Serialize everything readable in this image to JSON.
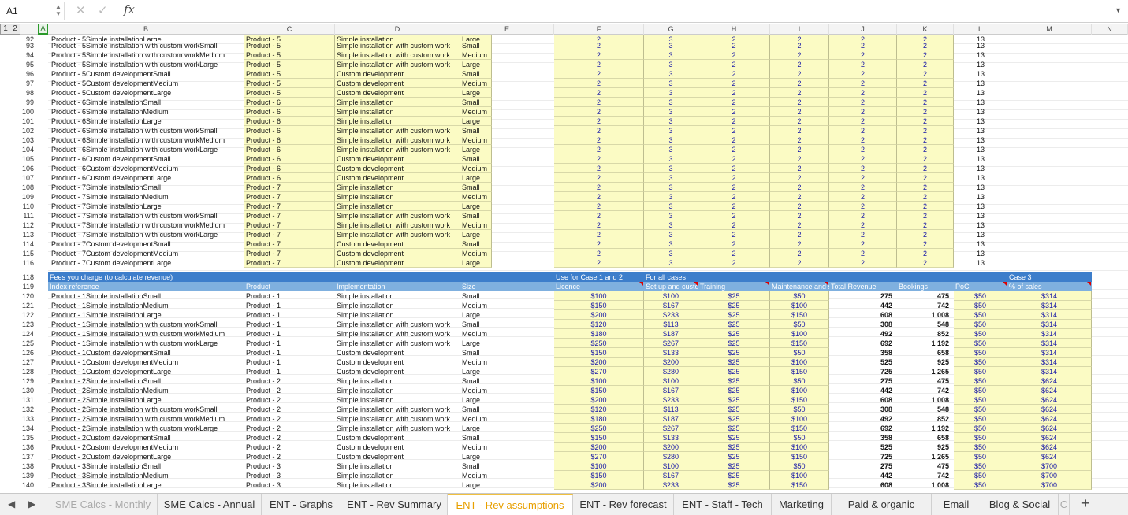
{
  "formula_bar": {
    "cell_ref": "A1",
    "fx": "fx",
    "value": "",
    "cancel_glyph": "✕",
    "confirm_glyph": "✓"
  },
  "outline_levels": [
    "1",
    "2"
  ],
  "columns": [
    "A",
    "B",
    "C",
    "D",
    "E",
    "F",
    "G",
    "H",
    "I",
    "J",
    "K",
    "L",
    "M",
    "N"
  ],
  "top_rows": {
    "numbers": [
      "92",
      "93",
      "94",
      "95",
      "96",
      "97",
      "98",
      "99",
      "100",
      "101",
      "102",
      "103",
      "104",
      "105",
      "106",
      "107",
      "108",
      "109",
      "110",
      "111",
      "112",
      "113",
      "114",
      "115",
      "116"
    ],
    "B": [
      "Product - 5Simple installationLarge",
      "Product - 5Simple installation with custom workSmall",
      "Product - 5Simple installation with custom workMedium",
      "Product - 5Simple installation with custom workLarge",
      "Product - 5Custom developmentSmall",
      "Product - 5Custom developmentMedium",
      "Product - 5Custom developmentLarge",
      "Product - 6Simple installationSmall",
      "Product - 6Simple installationMedium",
      "Product - 6Simple installationLarge",
      "Product - 6Simple installation with custom workSmall",
      "Product - 6Simple installation with custom workMedium",
      "Product - 6Simple installation with custom workLarge",
      "Product - 6Custom developmentSmall",
      "Product - 6Custom developmentMedium",
      "Product - 6Custom developmentLarge",
      "Product - 7Simple installationSmall",
      "Product - 7Simple installationMedium",
      "Product - 7Simple installationLarge",
      "Product - 7Simple installation with custom workSmall",
      "Product - 7Simple installation with custom workMedium",
      "Product - 7Simple installation with custom workLarge",
      "Product - 7Custom developmentSmall",
      "Product - 7Custom developmentMedium",
      "Product - 7Custom developmentLarge"
    ],
    "C": [
      "Product - 5",
      "Product - 5",
      "Product - 5",
      "Product - 5",
      "Product - 5",
      "Product - 5",
      "Product - 5",
      "Product - 6",
      "Product - 6",
      "Product - 6",
      "Product - 6",
      "Product - 6",
      "Product - 6",
      "Product - 6",
      "Product - 6",
      "Product - 6",
      "Product - 7",
      "Product - 7",
      "Product - 7",
      "Product - 7",
      "Product - 7",
      "Product - 7",
      "Product - 7",
      "Product - 7",
      "Product - 7"
    ],
    "D": [
      "Simple installation",
      "Simple installation with custom work",
      "Simple installation with custom work",
      "Simple installation with custom work",
      "Custom development",
      "Custom development",
      "Custom development",
      "Simple installation",
      "Simple installation",
      "Simple installation",
      "Simple installation with custom work",
      "Simple installation with custom work",
      "Simple installation with custom work",
      "Custom development",
      "Custom development",
      "Custom development",
      "Simple installation",
      "Simple installation",
      "Simple installation",
      "Simple installation with custom work",
      "Simple installation with custom work",
      "Simple installation with custom work",
      "Custom development",
      "Custom development",
      "Custom development"
    ],
    "E": [
      "Large",
      "Small",
      "Medium",
      "Large",
      "Small",
      "Medium",
      "Large",
      "Small",
      "Medium",
      "Large",
      "Small",
      "Medium",
      "Large",
      "Small",
      "Medium",
      "Large",
      "Small",
      "Medium",
      "Large",
      "Small",
      "Medium",
      "Large",
      "Small",
      "Medium",
      "Large"
    ],
    "F": "2",
    "G": "3",
    "H": "2",
    "I": "2",
    "J": "2",
    "K": "2",
    "L": "13"
  },
  "section2": {
    "header_row_number": "118",
    "header_title": "Fees you charge (to calculate revenue)",
    "header_use_case": "Use for Case 1 and 2",
    "header_all_cases": "For all cases",
    "header_case3": "Case 3",
    "subheader_row_number": "119",
    "subheaders": {
      "B": "Index reference",
      "C": "Product",
      "D": "Implementation",
      "E": "Size",
      "F": "Licence",
      "G": "Set up and customisation",
      "H": "Training",
      "I": "Maintenance and support",
      "J": "Total Revenue",
      "K": "Bookings",
      "L": "PoC",
      "M": "% of sales"
    },
    "numbers": [
      "120",
      "121",
      "122",
      "123",
      "124",
      "125",
      "126",
      "127",
      "128",
      "129",
      "130",
      "131",
      "132",
      "133",
      "134",
      "135",
      "136",
      "137",
      "138",
      "139",
      "140"
    ],
    "B": [
      "Product - 1Simple installationSmall",
      "Product - 1Simple installationMedium",
      "Product - 1Simple installationLarge",
      "Product - 1Simple installation with custom workSmall",
      "Product - 1Simple installation with custom workMedium",
      "Product - 1Simple installation with custom workLarge",
      "Product - 1Custom developmentSmall",
      "Product - 1Custom developmentMedium",
      "Product - 1Custom developmentLarge",
      "Product - 2Simple installationSmall",
      "Product - 2Simple installationMedium",
      "Product - 2Simple installationLarge",
      "Product - 2Simple installation with custom workSmall",
      "Product - 2Simple installation with custom workMedium",
      "Product - 2Simple installation with custom workLarge",
      "Product - 2Custom developmentSmall",
      "Product - 2Custom developmentMedium",
      "Product - 2Custom developmentLarge",
      "Product - 3Simple installationSmall",
      "Product - 3Simple installationMedium",
      "Product - 3Simple installationLarge"
    ],
    "C": [
      "Product - 1",
      "Product - 1",
      "Product - 1",
      "Product - 1",
      "Product - 1",
      "Product - 1",
      "Product - 1",
      "Product - 1",
      "Product - 1",
      "Product - 2",
      "Product - 2",
      "Product - 2",
      "Product - 2",
      "Product - 2",
      "Product - 2",
      "Product - 2",
      "Product - 2",
      "Product - 2",
      "Product - 3",
      "Product - 3",
      "Product - 3"
    ],
    "D": [
      "Simple installation",
      "Simple installation",
      "Simple installation",
      "Simple installation with custom work",
      "Simple installation with custom work",
      "Simple installation with custom work",
      "Custom development",
      "Custom development",
      "Custom development",
      "Simple installation",
      "Simple installation",
      "Simple installation",
      "Simple installation with custom work",
      "Simple installation with custom work",
      "Simple installation with custom work",
      "Custom development",
      "Custom development",
      "Custom development",
      "Simple installation",
      "Simple installation",
      "Simple installation"
    ],
    "E": [
      "Small",
      "Medium",
      "Large",
      "Small",
      "Medium",
      "Large",
      "Small",
      "Medium",
      "Large",
      "Small",
      "Medium",
      "Large",
      "Small",
      "Medium",
      "Large",
      "Small",
      "Medium",
      "Large",
      "Small",
      "Medium",
      "Large"
    ],
    "F": [
      "$100",
      "$150",
      "$200",
      "$120",
      "$180",
      "$250",
      "$150",
      "$200",
      "$270",
      "$100",
      "$150",
      "$200",
      "$120",
      "$180",
      "$250",
      "$150",
      "$200",
      "$270",
      "$100",
      "$150",
      "$200"
    ],
    "G": [
      "$100",
      "$167",
      "$233",
      "$113",
      "$187",
      "$267",
      "$133",
      "$200",
      "$280",
      "$100",
      "$167",
      "$233",
      "$113",
      "$187",
      "$267",
      "$133",
      "$200",
      "$280",
      "$100",
      "$167",
      "$233"
    ],
    "H": [
      "$25",
      "$25",
      "$25",
      "$25",
      "$25",
      "$25",
      "$25",
      "$25",
      "$25",
      "$25",
      "$25",
      "$25",
      "$25",
      "$25",
      "$25",
      "$25",
      "$25",
      "$25",
      "$25",
      "$25",
      "$25"
    ],
    "I": [
      "$50",
      "$100",
      "$150",
      "$50",
      "$100",
      "$150",
      "$50",
      "$100",
      "$150",
      "$50",
      "$100",
      "$150",
      "$50",
      "$100",
      "$150",
      "$50",
      "$100",
      "$150",
      "$50",
      "$100",
      "$150"
    ],
    "J": [
      "275",
      "442",
      "608",
      "308",
      "492",
      "692",
      "358",
      "525",
      "725",
      "275",
      "442",
      "608",
      "308",
      "492",
      "692",
      "358",
      "525",
      "725",
      "275",
      "442",
      "608"
    ],
    "K": [
      "475",
      "742",
      "1 008",
      "548",
      "852",
      "1 192",
      "658",
      "925",
      "1 265",
      "475",
      "742",
      "1 008",
      "548",
      "852",
      "1 192",
      "658",
      "925",
      "1 265",
      "475",
      "742",
      "1 008"
    ],
    "L": [
      "$50",
      "$50",
      "$50",
      "$50",
      "$50",
      "$50",
      "$50",
      "$50",
      "$50",
      "$50",
      "$50",
      "$50",
      "$50",
      "$50",
      "$50",
      "$50",
      "$50",
      "$50",
      "$50",
      "$50",
      "$50"
    ],
    "M": [
      "$314",
      "$314",
      "$314",
      "$314",
      "$314",
      "$314",
      "$314",
      "$314",
      "$314",
      "$624",
      "$624",
      "$624",
      "$624",
      "$624",
      "$624",
      "$624",
      "$624",
      "$624",
      "$700",
      "$700",
      "$700"
    ]
  },
  "sheet_tabs": [
    "SME Calcs - Monthly",
    "SME Calcs - Annual",
    "ENT - Graphs",
    "ENT - Rev Summary",
    "ENT - Rev assumptions",
    "ENT - Rev forecast",
    "ENT - Staff - Tech",
    "Marketing",
    "Paid & organic",
    "Email",
    "Blog & Social",
    "C"
  ],
  "active_tab": "ENT - Rev assumptions",
  "tab_nav": {
    "prev": "◀",
    "next": "▶",
    "add": "+"
  }
}
